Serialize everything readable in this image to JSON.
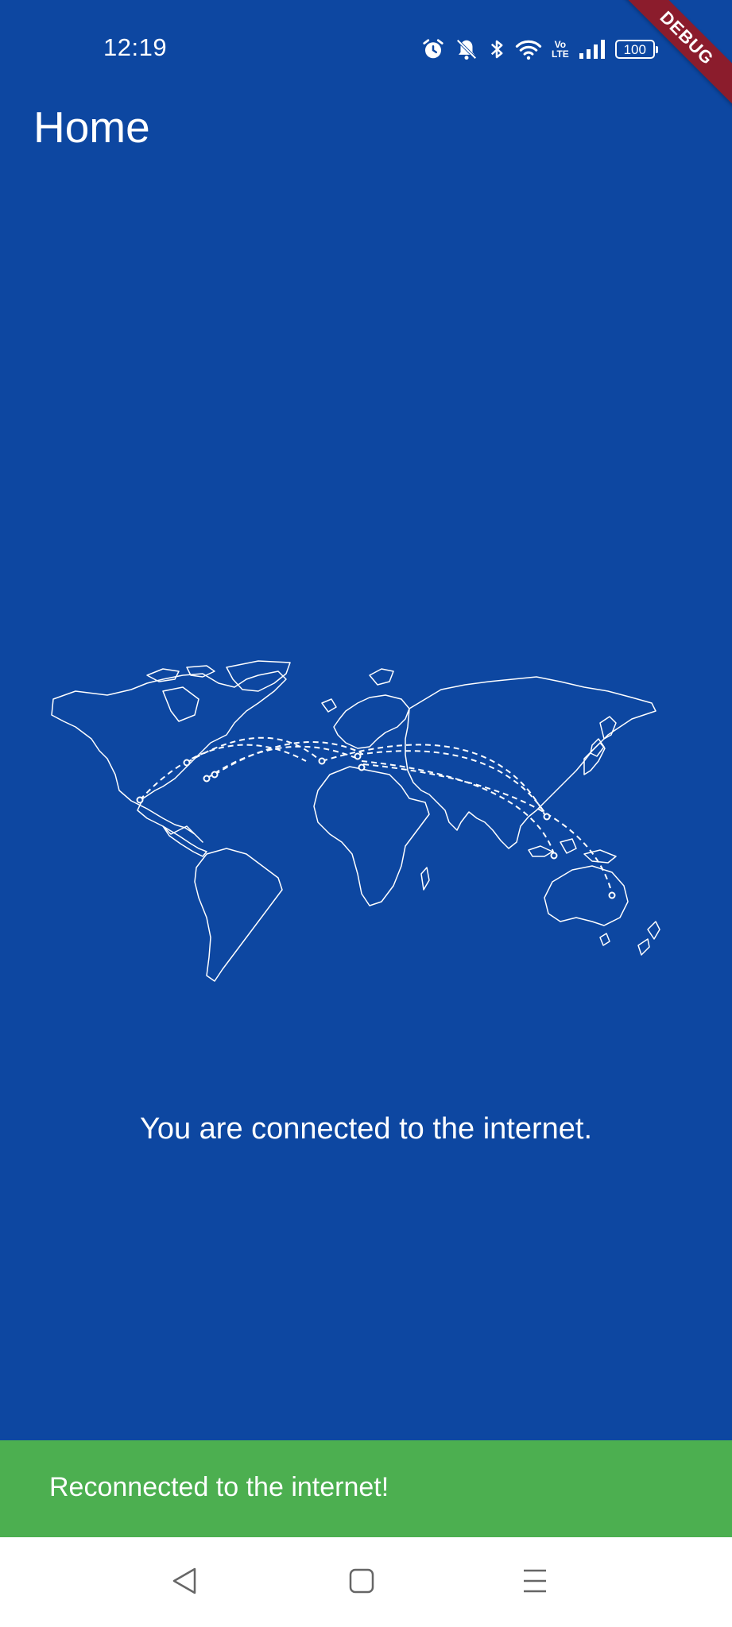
{
  "status_bar": {
    "time": "12:19",
    "battery_level": "100",
    "network_label_top": "Vo",
    "network_label_bottom": "LTE",
    "icons": [
      "alarm-icon",
      "mute-icon",
      "bluetooth-icon",
      "wifi-icon",
      "volte-icon",
      "signal-icon",
      "battery-icon"
    ]
  },
  "debug_banner": {
    "label": "DEBUG"
  },
  "app_bar": {
    "title": "Home"
  },
  "main": {
    "map_icon": "world-map-connections-icon",
    "message": "You are connected to the internet."
  },
  "snackbar": {
    "message": "Reconnected to the internet!",
    "color": "#4caf50"
  },
  "nav_bar": {
    "buttons": [
      "back-icon",
      "home-icon",
      "menu-icon"
    ]
  },
  "colors": {
    "background": "#0d47a1",
    "debug_banner": "#8b1c2c",
    "nav_bar": "#ffffff"
  }
}
